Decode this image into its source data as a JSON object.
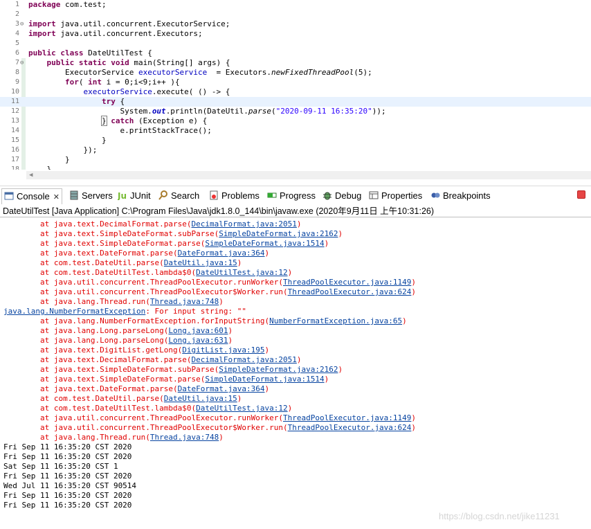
{
  "editor": {
    "lines": [
      {
        "n": "1",
        "fold": "",
        "segs": [
          {
            "t": "package",
            "c": "kw"
          },
          {
            "t": " com.test;",
            "c": ""
          }
        ]
      },
      {
        "n": "2",
        "fold": "",
        "segs": []
      },
      {
        "n": "3",
        "fold": "⊖",
        "segs": [
          {
            "t": "import",
            "c": "kw"
          },
          {
            "t": " java.util.concurrent.ExecutorService;",
            "c": ""
          }
        ]
      },
      {
        "n": "4",
        "fold": "",
        "segs": [
          {
            "t": "import",
            "c": "kw"
          },
          {
            "t": " java.util.concurrent.Executors;",
            "c": ""
          }
        ]
      },
      {
        "n": "5",
        "fold": "",
        "segs": []
      },
      {
        "n": "6",
        "fold": "",
        "segs": [
          {
            "t": "public",
            "c": "kw"
          },
          {
            "t": " ",
            "c": ""
          },
          {
            "t": "class",
            "c": "kw"
          },
          {
            "t": " DateUtilTest {",
            "c": ""
          }
        ]
      },
      {
        "n": "7",
        "fold": "⊖",
        "segs": [
          {
            "t": "    ",
            "c": ""
          },
          {
            "t": "public",
            "c": "kw"
          },
          {
            "t": " ",
            "c": ""
          },
          {
            "t": "static",
            "c": "kw"
          },
          {
            "t": " ",
            "c": ""
          },
          {
            "t": "void",
            "c": "kw"
          },
          {
            "t": " main(String[] args) {",
            "c": ""
          }
        ]
      },
      {
        "n": "8",
        "fold": "",
        "segs": [
          {
            "t": "        ExecutorService ",
            "c": ""
          },
          {
            "t": "executorService",
            "c": "fld"
          },
          {
            "t": "  = Executors.",
            "c": ""
          },
          {
            "t": "newFixedThreadPool",
            "c": "it"
          },
          {
            "t": "(5);",
            "c": ""
          }
        ]
      },
      {
        "n": "9",
        "fold": "",
        "segs": [
          {
            "t": "        ",
            "c": ""
          },
          {
            "t": "for",
            "c": "kw"
          },
          {
            "t": "( ",
            "c": ""
          },
          {
            "t": "int",
            "c": "kw"
          },
          {
            "t": " i = 0;i<9;i++ ){",
            "c": ""
          }
        ]
      },
      {
        "n": "10",
        "fold": "",
        "segs": [
          {
            "t": "            ",
            "c": ""
          },
          {
            "t": "executorService",
            "c": "fld"
          },
          {
            "t": ".execute( () -> {",
            "c": ""
          }
        ]
      },
      {
        "n": "11",
        "fold": "",
        "cur": true,
        "segs": [
          {
            "t": "                ",
            "c": ""
          },
          {
            "t": "try",
            "c": "kw"
          },
          {
            "t": " {",
            "c": ""
          }
        ]
      },
      {
        "n": "12",
        "fold": "",
        "segs": [
          {
            "t": "                    System.",
            "c": ""
          },
          {
            "t": "out",
            "c": "itf"
          },
          {
            "t": ".println(DateUtil.",
            "c": ""
          },
          {
            "t": "parse",
            "c": "it"
          },
          {
            "t": "(",
            "c": ""
          },
          {
            "t": "\"2020-09-11 16:35:20\"",
            "c": "str"
          },
          {
            "t": "));",
            "c": ""
          }
        ]
      },
      {
        "n": "13",
        "fold": "",
        "segs": [
          {
            "t": "                ",
            "c": ""
          },
          {
            "t": "}",
            "c": "brk"
          },
          {
            "t": " ",
            "c": ""
          },
          {
            "t": "catch",
            "c": "kw"
          },
          {
            "t": " (Exception e) {",
            "c": ""
          }
        ]
      },
      {
        "n": "14",
        "fold": "",
        "segs": [
          {
            "t": "                    e.printStackTrace();",
            "c": ""
          }
        ]
      },
      {
        "n": "15",
        "fold": "",
        "segs": [
          {
            "t": "                }",
            "c": ""
          }
        ]
      },
      {
        "n": "16",
        "fold": "",
        "segs": [
          {
            "t": "            });",
            "c": ""
          }
        ]
      },
      {
        "n": "17",
        "fold": "",
        "segs": [
          {
            "t": "        }",
            "c": ""
          }
        ]
      },
      {
        "n": "18",
        "fold": "",
        "segs": [
          {
            "t": "    }",
            "c": ""
          }
        ]
      }
    ]
  },
  "tabs": [
    {
      "label": "Console",
      "icon": "console-icon",
      "active": true,
      "close": "✕"
    },
    {
      "label": "Servers",
      "icon": "servers-icon"
    },
    {
      "label": "JUnit",
      "icon": "junit-icon"
    },
    {
      "label": "Search",
      "icon": "search-icon"
    },
    {
      "label": "Problems",
      "icon": "problems-icon"
    },
    {
      "label": "Progress",
      "icon": "progress-icon"
    },
    {
      "label": "Debug",
      "icon": "debug-icon"
    },
    {
      "label": "Properties",
      "icon": "properties-icon"
    },
    {
      "label": "Breakpoints",
      "icon": "breakpoints-icon"
    }
  ],
  "console": {
    "title": "DateUtilTest [Java Application] C:\\Program Files\\Java\\jdk1.8.0_144\\bin\\javaw.exe (2020年9月11日 上午10:31:26)",
    "lines": [
      [
        {
          "t": "\tat java.text.DecimalFormat.parse(",
          "c": "err"
        },
        {
          "t": "DecimalFormat.java:2051",
          "c": "lnk"
        },
        {
          "t": ")",
          "c": "err"
        }
      ],
      [
        {
          "t": "\tat java.text.SimpleDateFormat.subParse(",
          "c": "err"
        },
        {
          "t": "SimpleDateFormat.java:2162",
          "c": "lnk"
        },
        {
          "t": ")",
          "c": "err"
        }
      ],
      [
        {
          "t": "\tat java.text.SimpleDateFormat.parse(",
          "c": "err"
        },
        {
          "t": "SimpleDateFormat.java:1514",
          "c": "lnk"
        },
        {
          "t": ")",
          "c": "err"
        }
      ],
      [
        {
          "t": "\tat java.text.DateFormat.parse(",
          "c": "err"
        },
        {
          "t": "DateFormat.java:364",
          "c": "lnk"
        },
        {
          "t": ")",
          "c": "err"
        }
      ],
      [
        {
          "t": "\tat com.test.DateUtil.parse(",
          "c": "err"
        },
        {
          "t": "DateUtil.java:15",
          "c": "lnk"
        },
        {
          "t": ")",
          "c": "err"
        }
      ],
      [
        {
          "t": "\tat com.test.DateUtilTest.lambda$0(",
          "c": "err"
        },
        {
          "t": "DateUtilTest.java:12",
          "c": "lnk"
        },
        {
          "t": ")",
          "c": "err"
        }
      ],
      [
        {
          "t": "\tat java.util.concurrent.ThreadPoolExecutor.runWorker(",
          "c": "err"
        },
        {
          "t": "ThreadPoolExecutor.java:1149",
          "c": "lnk"
        },
        {
          "t": ")",
          "c": "err"
        }
      ],
      [
        {
          "t": "\tat java.util.concurrent.ThreadPoolExecutor$Worker.run(",
          "c": "err"
        },
        {
          "t": "ThreadPoolExecutor.java:624",
          "c": "lnk"
        },
        {
          "t": ")",
          "c": "err"
        }
      ],
      [
        {
          "t": "\tat java.lang.Thread.run(",
          "c": "err"
        },
        {
          "t": "Thread.java:748",
          "c": "lnk"
        },
        {
          "t": ")",
          "c": "err"
        }
      ],
      [
        {
          "t": "java.lang.NumberFormatException",
          "c": "lnk"
        },
        {
          "t": ": For input string: \"\"",
          "c": "err"
        }
      ],
      [
        {
          "t": "\tat java.lang.NumberFormatException.forInputString(",
          "c": "err"
        },
        {
          "t": "NumberFormatException.java:65",
          "c": "lnk"
        },
        {
          "t": ")",
          "c": "err"
        }
      ],
      [
        {
          "t": "\tat java.lang.Long.parseLong(",
          "c": "err"
        },
        {
          "t": "Long.java:601",
          "c": "lnk"
        },
        {
          "t": ")",
          "c": "err"
        }
      ],
      [
        {
          "t": "\tat java.lang.Long.parseLong(",
          "c": "err"
        },
        {
          "t": "Long.java:631",
          "c": "lnk"
        },
        {
          "t": ")",
          "c": "err"
        }
      ],
      [
        {
          "t": "\tat java.text.DigitList.getLong(",
          "c": "err"
        },
        {
          "t": "DigitList.java:195",
          "c": "lnk"
        },
        {
          "t": ")",
          "c": "err"
        }
      ],
      [
        {
          "t": "\tat java.text.DecimalFormat.parse(",
          "c": "err"
        },
        {
          "t": "DecimalFormat.java:2051",
          "c": "lnk"
        },
        {
          "t": ")",
          "c": "err"
        }
      ],
      [
        {
          "t": "\tat java.text.SimpleDateFormat.subParse(",
          "c": "err"
        },
        {
          "t": "SimpleDateFormat.java:2162",
          "c": "lnk"
        },
        {
          "t": ")",
          "c": "err"
        }
      ],
      [
        {
          "t": "\tat java.text.SimpleDateFormat.parse(",
          "c": "err"
        },
        {
          "t": "SimpleDateFormat.java:1514",
          "c": "lnk"
        },
        {
          "t": ")",
          "c": "err"
        }
      ],
      [
        {
          "t": "\tat java.text.DateFormat.parse(",
          "c": "err"
        },
        {
          "t": "DateFormat.java:364",
          "c": "lnk"
        },
        {
          "t": ")",
          "c": "err"
        }
      ],
      [
        {
          "t": "\tat com.test.DateUtil.parse(",
          "c": "err"
        },
        {
          "t": "DateUtil.java:15",
          "c": "lnk"
        },
        {
          "t": ")",
          "c": "err"
        }
      ],
      [
        {
          "t": "\tat com.test.DateUtilTest.lambda$0(",
          "c": "err"
        },
        {
          "t": "DateUtilTest.java:12",
          "c": "lnk"
        },
        {
          "t": ")",
          "c": "err"
        }
      ],
      [
        {
          "t": "\tat java.util.concurrent.ThreadPoolExecutor.runWorker(",
          "c": "err"
        },
        {
          "t": "ThreadPoolExecutor.java:1149",
          "c": "lnk"
        },
        {
          "t": ")",
          "c": "err"
        }
      ],
      [
        {
          "t": "\tat java.util.concurrent.ThreadPoolExecutor$Worker.run(",
          "c": "err"
        },
        {
          "t": "ThreadPoolExecutor.java:624",
          "c": "lnk"
        },
        {
          "t": ")",
          "c": "err"
        }
      ],
      [
        {
          "t": "\tat java.lang.Thread.run(",
          "c": "err"
        },
        {
          "t": "Thread.java:748",
          "c": "lnk"
        },
        {
          "t": ")",
          "c": "err"
        }
      ],
      [
        {
          "t": "Fri Sep 11 16:35:20 CST 2020",
          "c": "out"
        }
      ],
      [
        {
          "t": "Fri Sep 11 16:35:20 CST 2020",
          "c": "out"
        }
      ],
      [
        {
          "t": "Sat Sep 11 16:35:20 CST 1",
          "c": "out"
        }
      ],
      [
        {
          "t": "Fri Sep 11 16:35:20 CST 2020",
          "c": "out"
        }
      ],
      [
        {
          "t": "Wed Jul 11 16:35:20 CST 90514",
          "c": "out"
        }
      ],
      [
        {
          "t": "Fri Sep 11 16:35:20 CST 2020",
          "c": "out"
        }
      ],
      [
        {
          "t": "Fri Sep 11 16:35:20 CST 2020",
          "c": "out"
        }
      ]
    ]
  },
  "watermark": "https://blog.csdn.net/jike11231",
  "colors": {
    "keyword": "#7f0055",
    "field": "#0000c0",
    "string": "#2a00ff",
    "error": "#e00000",
    "link": "#0643a0",
    "current_line": "#e8f2fe",
    "stop": "#e64545"
  }
}
